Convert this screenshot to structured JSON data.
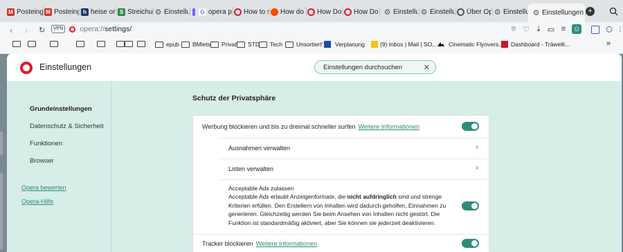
{
  "tabs": [
    {
      "label": "Posteinga",
      "icon": "gmail-icon",
      "color": "#d93025"
    },
    {
      "label": "Posteinga",
      "icon": "gmail-icon",
      "color": "#d93025"
    },
    {
      "label": "heise onli",
      "icon": "heise-icon",
      "color": "#1c3b6e"
    },
    {
      "label": "Streichun",
      "icon": "script-icon",
      "color": "#2d8a4e"
    },
    {
      "label": "Einstellun",
      "icon": "gear-icon",
      "color": "#555555"
    },
    {
      "label": "",
      "icon": "purple-tab-icon",
      "color": "#7b5cff"
    },
    {
      "label": "opera priv",
      "icon": "google-icon",
      "color": "#4285f4"
    },
    {
      "label": "How to se",
      "icon": "opera-icon",
      "color": "#e0192b"
    },
    {
      "label": "How do I",
      "icon": "reddit-icon",
      "color": "#ff4500"
    },
    {
      "label": "How Do I",
      "icon": "opera-icon",
      "color": "#e0192b"
    },
    {
      "label": "How Do I",
      "icon": "opera-icon",
      "color": "#e0192b"
    },
    {
      "label": "Einstellun",
      "icon": "gear-icon",
      "color": "#555555"
    },
    {
      "label": "Einstellun",
      "icon": "gear-icon",
      "color": "#555555"
    },
    {
      "label": "Über Ope",
      "icon": "opera-icon",
      "color": "#555555"
    },
    {
      "label": "Einstellun",
      "icon": "gear-icon",
      "color": "#555555"
    },
    {
      "label": "Einstellungen",
      "icon": "gear-icon",
      "color": "#555555",
      "active": true
    }
  ],
  "address": {
    "vpn": "VPN",
    "url_prefix": "opera://",
    "url_main": "settings/"
  },
  "bookmarks": [
    {
      "label": "",
      "kind": "folder"
    },
    {
      "label": "",
      "kind": "folder"
    },
    {
      "label": "",
      "kind": "folder"
    },
    {
      "label": "",
      "kind": "folder"
    },
    {
      "label": "",
      "kind": "folder"
    },
    {
      "label": "",
      "kind": "folder"
    },
    {
      "label": "",
      "kind": "folder"
    },
    {
      "label": "",
      "kind": "folder"
    },
    {
      "label": "epub",
      "kind": "folder"
    },
    {
      "label": "BMlets",
      "kind": "folder"
    },
    {
      "label": "Privat",
      "kind": "folder"
    },
    {
      "label": "STD",
      "kind": "folder"
    },
    {
      "label": "Tech",
      "kind": "folder"
    },
    {
      "label": "Unsortiert'",
      "kind": "folder"
    },
    {
      "label": "Verplanung",
      "kind": "site"
    },
    {
      "label": "(9) Inbox | Mail | SO...",
      "kind": "site"
    },
    {
      "label": "Cinematic Flyovers...",
      "kind": "site"
    },
    {
      "label": "Dashboard - Träwelli...",
      "kind": "site"
    },
    {
      "label": "»",
      "kind": "more"
    }
  ],
  "header": {
    "title": "Einstellungen",
    "search_text": "Einstellungen durchsuchen",
    "clear_glyph": "✕"
  },
  "sidebar": {
    "items": [
      "Grundeinstellungen",
      "Datenschutz & Sicherheit",
      "Funktionen",
      "Browser"
    ],
    "links": [
      "Opera bewerten",
      "Opera-Hilfe"
    ]
  },
  "section": {
    "title": "Schutz der Privatsphäre",
    "adblock": {
      "label": "Werbung blockieren und bis zu dreimal schneller surfen",
      "more": "Weitere Informationen",
      "enabled": true
    },
    "exceptions": "Ausnahmen verwalten",
    "lists": "Listen verwalten",
    "acceptable_ads": {
      "title": "Acceptable Ads zulassen",
      "text_a": "Acceptable Ads erlaubt Anzeigenformate, die ",
      "text_bold": "nicht aufdringlich",
      "text_b": " sind und strenge Kriterien erfüllen. Den Erstellern von Inhalten wird dadurch geholfen, Einnahmen zu generieren. Gleichzeitig werden Sie beim Ansehen von Inhalten nicht gestört. Die Funktion ist standardmäßig aktiviert, aber Sie können sie jederzeit deaktivieren.",
      "enabled": true
    },
    "tracker": {
      "label": "Tracker blockieren",
      "more": "Weitere Informationen",
      "enabled": true
    }
  },
  "colors": {
    "accent": "#2e8c7a",
    "sidebar_bg": "#d6ede8",
    "opera_red": "#e0192b"
  }
}
